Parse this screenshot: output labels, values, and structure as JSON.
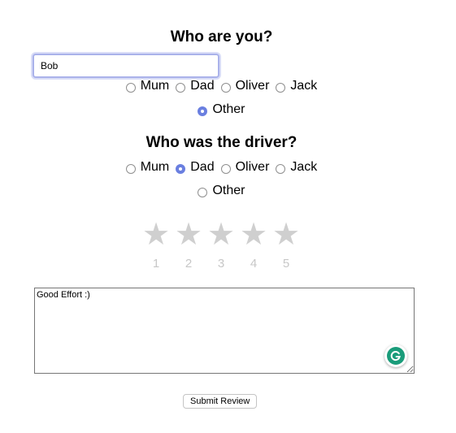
{
  "who_section": {
    "title": "Who are you?",
    "name_value": "Bob",
    "options": [
      "Mum",
      "Dad",
      "Oliver",
      "Jack",
      "Other"
    ],
    "selected": "Other"
  },
  "driver_section": {
    "title": "Who was the driver?",
    "options": [
      "Mum",
      "Dad",
      "Oliver",
      "Jack",
      "Other"
    ],
    "selected": "Dad"
  },
  "rating": {
    "icon": "star-icon",
    "labels": [
      "1",
      "2",
      "3",
      "4",
      "5"
    ],
    "selected_value": 0,
    "star_color": "#cfcfcf"
  },
  "comment": {
    "value": "Good Effort :)"
  },
  "grammarly": {
    "icon": "grammarly-icon",
    "color": "#1a9c7a"
  },
  "submit_label": "Submit Review",
  "colors": {
    "accent": "#6a7fe0",
    "input_focus_border": "#aab2ea"
  }
}
